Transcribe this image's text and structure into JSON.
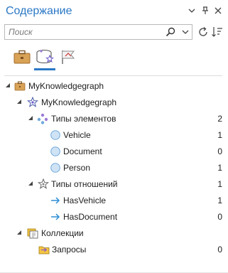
{
  "pane": {
    "title": "Содержание",
    "search_placeholder": "Поиск"
  },
  "icons": {
    "menu": "chevron-down-icon",
    "pin": "pin-icon",
    "close": "close-icon",
    "search": "search-icon",
    "search_dropdown": "chevron-down-icon",
    "refresh": "refresh-icon",
    "sort": "sort-icon",
    "tab_cards": "briefcase-icon",
    "tab_database": "database-star-icon",
    "tab_links": "flag-link-icon"
  },
  "colors": {
    "accent": "#2b78c5",
    "entity_circle": "#cfe3f5",
    "arrow": "#2f8fd5"
  },
  "tree": {
    "root": {
      "label": "MyKnowledgegraph"
    },
    "graph": {
      "label": "MyKnowledgegraph"
    },
    "entity_types": {
      "label": "Типы элементов",
      "count": "2"
    },
    "entities": [
      {
        "label": "Vehicle",
        "count": "1"
      },
      {
        "label": "Document",
        "count": "0"
      },
      {
        "label": "Person",
        "count": "1"
      }
    ],
    "relationship_types": {
      "label": "Типы отношений",
      "count": "1"
    },
    "relationships": [
      {
        "label": "HasVehicle",
        "count": "1"
      },
      {
        "label": "HasDocument",
        "count": "0"
      }
    ],
    "collections": {
      "label": "Коллекции"
    },
    "queries": {
      "label": "Запросы",
      "count": "0"
    }
  }
}
